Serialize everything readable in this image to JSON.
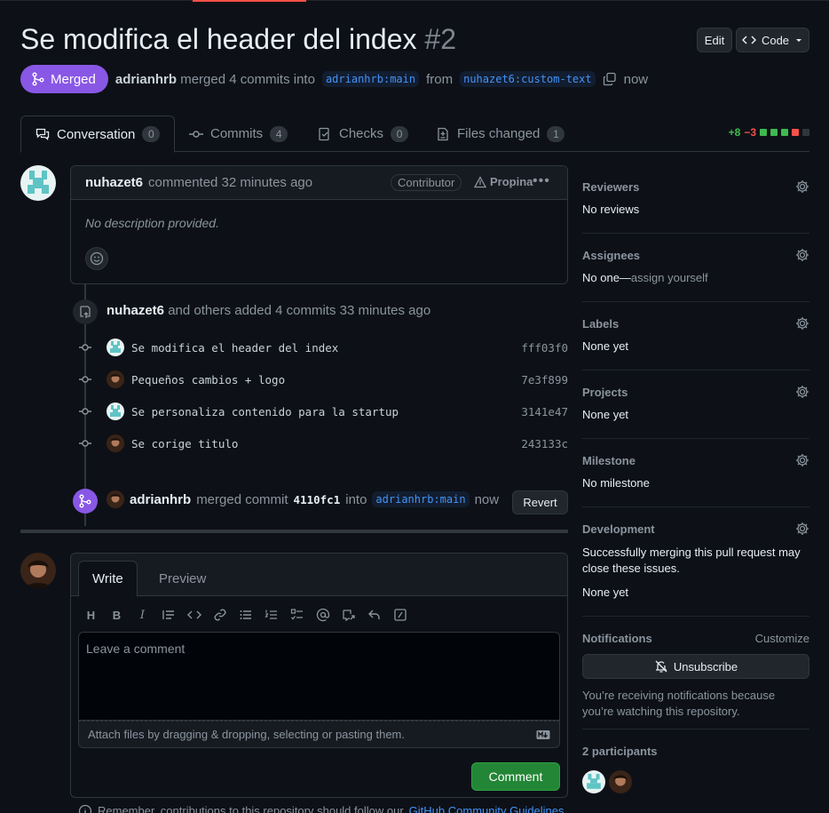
{
  "header": {
    "title": "Se modifica el header del index",
    "number": "#2",
    "edit_label": "Edit",
    "code_label": "Code"
  },
  "state": {
    "badge": "Merged",
    "author": "adrianhrb",
    "text_merged": "merged 4 commits into",
    "base_branch": "adrianhrb:main",
    "text_from": "from",
    "head_branch": "nuhazet6:custom-text",
    "time": "now"
  },
  "tabs": [
    {
      "label": "Conversation",
      "count": "0"
    },
    {
      "label": "Commits",
      "count": "4"
    },
    {
      "label": "Checks",
      "count": "0"
    },
    {
      "label": "Files changed",
      "count": "1"
    }
  ],
  "diffstat": {
    "additions": "+8",
    "deletions": "−3"
  },
  "comment": {
    "author": "nuhazet6",
    "meta": "commented 32 minutes ago",
    "badge": "Contributor",
    "sponsor": "Propina",
    "body": "No description provided."
  },
  "commits_event": {
    "author": "nuhazet6",
    "text": "and others added 4 commits 33 minutes ago",
    "commits": [
      {
        "message": "Se modifica el header del index",
        "sha": "fff03f0",
        "avatar": "teal"
      },
      {
        "message": "Pequeños cambios + logo",
        "sha": "7e3f899",
        "avatar": "dark"
      },
      {
        "message": "Se personaliza contenido para la startup",
        "sha": "3141e47",
        "avatar": "teal"
      },
      {
        "message": "Se corige titulo",
        "sha": "243133c",
        "avatar": "dark"
      }
    ]
  },
  "merge_event": {
    "author": "adrianhrb",
    "text": "merged commit",
    "sha": "4110fc1",
    "into": "into",
    "branch": "adrianhrb:main",
    "time": "now",
    "revert_label": "Revert"
  },
  "editor": {
    "tab_write": "Write",
    "tab_preview": "Preview",
    "placeholder": "Leave a comment",
    "attach_text": "Attach files by dragging & dropping, selecting or pasting them.",
    "submit_label": "Comment"
  },
  "footer_note": {
    "text": "Remember, contributions to this repository should follow our",
    "link": "GitHub Community Guidelines"
  },
  "sidebar": {
    "reviewers": {
      "title": "Reviewers",
      "value": "No reviews"
    },
    "assignees": {
      "title": "Assignees",
      "value": "No one—",
      "action": "assign yourself"
    },
    "labels": {
      "title": "Labels",
      "value": "None yet"
    },
    "projects": {
      "title": "Projects",
      "value": "None yet"
    },
    "milestone": {
      "title": "Milestone",
      "value": "No milestone"
    },
    "development": {
      "title": "Development",
      "description": "Successfully merging this pull request may close these issues.",
      "value": "None yet"
    },
    "notifications": {
      "title": "Notifications",
      "customize": "Customize",
      "button": "Unsubscribe",
      "note": "You’re receiving notifications because you’re watching this repository."
    },
    "participants": {
      "title": "2 participants"
    }
  },
  "colors": {
    "merged": "#8957e5",
    "link": "#4493f8",
    "success": "#238636",
    "danger": "#f85149",
    "background": "#0d1117"
  }
}
